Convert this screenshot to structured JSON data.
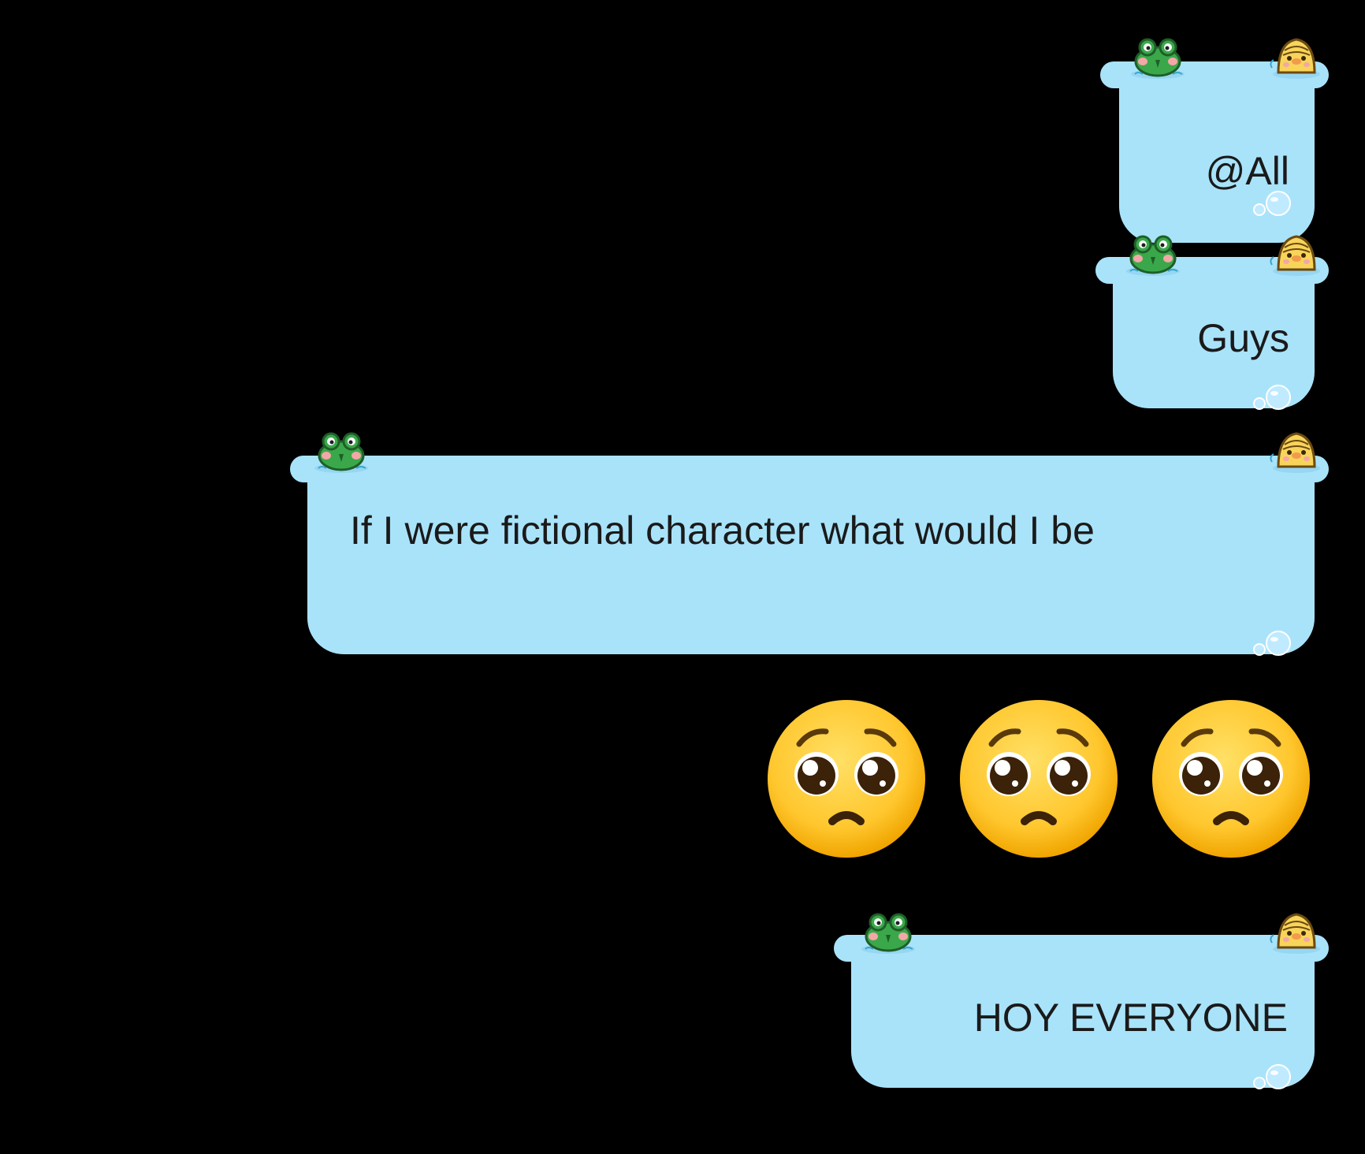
{
  "messages": [
    {
      "id": "msg1",
      "text": "@All"
    },
    {
      "id": "msg2",
      "text": "Guys"
    },
    {
      "id": "msg3",
      "text": "If I were fictional character what would I be"
    },
    {
      "id": "msg4",
      "emojis": [
        "pleading-face",
        "pleading-face",
        "pleading-face"
      ]
    },
    {
      "id": "msg5",
      "text": "HOY EVERYONE"
    }
  ],
  "bubble_theme": {
    "bubble_color": "#a9e3fa",
    "text_color": "#1a1a1a",
    "background_color": "#000000",
    "decorations": [
      "frog-icon",
      "duck-icon",
      "water-bubbles-icon"
    ]
  }
}
